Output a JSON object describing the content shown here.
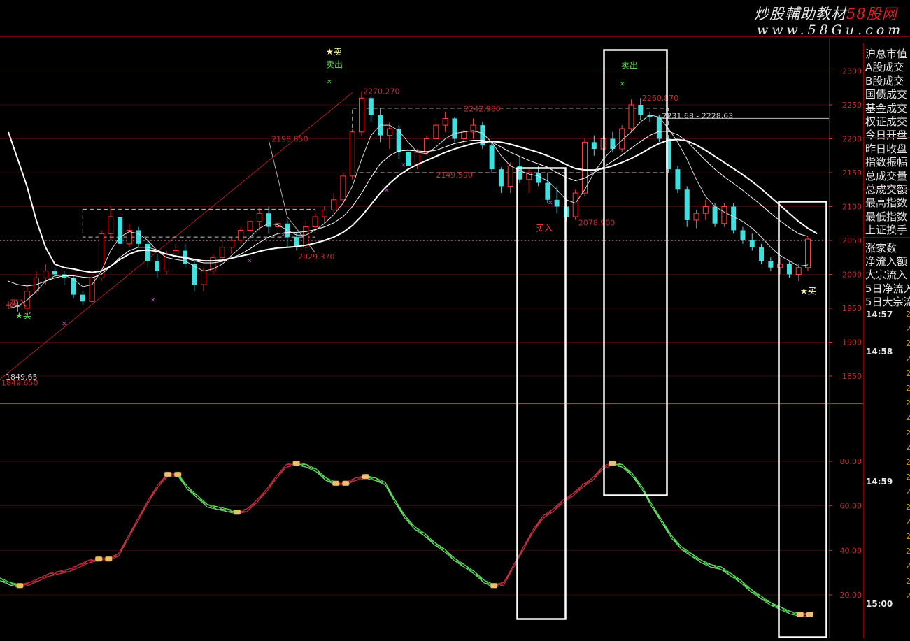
{
  "watermark": {
    "title_a": "炒股輔助教材",
    "title_b": "58股网",
    "url": "www.58Gu.com"
  },
  "panel": {
    "items": [
      "沪总市值",
      "A股成交",
      "B股成交",
      "国债成交",
      "基金成交",
      "权证成交",
      "今日开盘",
      "昨日收盘",
      "指数振幅",
      "总成交量",
      "总成交额",
      "最高指数",
      "最低指数",
      "上证换手",
      "涨家数",
      "净流入额",
      "大宗流入",
      "5日净流入",
      "5日大宗流"
    ],
    "times": [
      "14:57",
      "14:58",
      "14:59",
      "15:00"
    ],
    "digit": "2"
  },
  "colors": {
    "up": "#ff4040",
    "down": "#40e0e0",
    "axis": "#c03030",
    "frame": "#ffffff",
    "osc_up": "#c03040",
    "osc_down": "#60e060"
  },
  "chart_data": [
    {
      "type": "candlestick",
      "y_ticks": [
        1850,
        1900,
        1950,
        2000,
        2050,
        2100,
        2150,
        2200,
        2250,
        2300
      ],
      "ylim": [
        1820,
        2325
      ],
      "reference_level": 2050,
      "ohlc": [
        [
          1955,
          1960,
          1950,
          1955
        ],
        [
          1955,
          1960,
          1945,
          1952
        ],
        [
          1950,
          1985,
          1945,
          1975
        ],
        [
          1975,
          2005,
          1970,
          1995
        ],
        [
          1995,
          2015,
          1985,
          2005
        ],
        [
          2005,
          2010,
          1995,
          2000
        ],
        [
          2000,
          2005,
          1985,
          1995
        ],
        [
          1995,
          1998,
          1965,
          1970
        ],
        [
          1970,
          1975,
          1955,
          1960
        ],
        [
          1960,
          2000,
          1958,
          1995
        ],
        [
          1995,
          2065,
          1990,
          2060
        ],
        [
          2060,
          2100,
          2050,
          2085
        ],
        [
          2085,
          2090,
          2040,
          2045
        ],
        [
          2045,
          2075,
          2040,
          2065
        ],
        [
          2065,
          2070,
          2040,
          2045
        ],
        [
          2045,
          2050,
          2010,
          2020
        ],
        [
          2020,
          2030,
          1995,
          2005
        ],
        [
          2005,
          2035,
          2000,
          2030
        ],
        [
          2030,
          2045,
          2025,
          2035
        ],
        [
          2035,
          2045,
          2010,
          2015
        ],
        [
          2015,
          2020,
          1975,
          1985
        ],
        [
          1985,
          2010,
          1975,
          2005
        ],
        [
          2005,
          2030,
          2000,
          2025
        ],
        [
          2025,
          2050,
          2015,
          2040
        ],
        [
          2040,
          2055,
          2030,
          2050
        ],
        [
          2050,
          2070,
          2045,
          2065
        ],
        [
          2065,
          2085,
          2060,
          2078
        ],
        [
          2078,
          2098,
          2065,
          2090
        ],
        [
          2090,
          2100,
          2060,
          2070
        ],
        [
          2070,
          2085,
          2050,
          2075
        ],
        [
          2075,
          2080,
          2040,
          2055
        ],
        [
          2055,
          2062,
          2035,
          2040
        ],
        [
          2040,
          2080,
          2035,
          2070
        ],
        [
          2070,
          2090,
          2065,
          2085
        ],
        [
          2085,
          2100,
          2075,
          2095
        ],
        [
          2095,
          2120,
          2090,
          2110
        ],
        [
          2110,
          2150,
          2105,
          2145
        ],
        [
          2145,
          2215,
          2140,
          2210
        ],
        [
          2210,
          2270,
          2205,
          2260
        ],
        [
          2260,
          2262,
          2225,
          2235
        ],
        [
          2235,
          2245,
          2195,
          2205
        ],
        [
          2205,
          2225,
          2185,
          2215
        ],
        [
          2215,
          2220,
          2170,
          2180
        ],
        [
          2180,
          2185,
          2150,
          2160
        ],
        [
          2160,
          2185,
          2155,
          2180
        ],
        [
          2180,
          2205,
          2175,
          2200
        ],
        [
          2200,
          2230,
          2195,
          2220
        ],
        [
          2220,
          2240,
          2210,
          2230
        ],
        [
          2230,
          2232,
          2195,
          2200
        ],
        [
          2200,
          2215,
          2190,
          2210
        ],
        [
          2210,
          2230,
          2200,
          2220
        ],
        [
          2220,
          2225,
          2185,
          2190
        ],
        [
          2190,
          2195,
          2150,
          2155
        ],
        [
          2155,
          2158,
          2120,
          2130
        ],
        [
          2130,
          2165,
          2120,
          2160
        ],
        [
          2160,
          2175,
          2135,
          2140
        ],
        [
          2140,
          2158,
          2120,
          2150
        ],
        [
          2150,
          2160,
          2130,
          2135
        ],
        [
          2135,
          2150,
          2105,
          2110
        ],
        [
          2110,
          2130,
          2090,
          2100
        ],
        [
          2100,
          2112,
          2078,
          2085
        ],
        [
          2085,
          2125,
          2080,
          2120
        ],
        [
          2120,
          2200,
          2115,
          2195
        ],
        [
          2195,
          2205,
          2175,
          2185
        ],
        [
          2185,
          2205,
          2175,
          2200
        ],
        [
          2200,
          2210,
          2180,
          2185
        ],
        [
          2185,
          2220,
          2180,
          2215
        ],
        [
          2215,
          2258,
          2210,
          2250
        ],
        [
          2250,
          2260,
          2228,
          2235
        ],
        [
          2235,
          2240,
          2225,
          2232
        ],
        [
          2232,
          2235,
          2195,
          2200
        ],
        [
          2200,
          2205,
          2150,
          2155
        ],
        [
          2155,
          2160,
          2120,
          2125
        ],
        [
          2125,
          2130,
          2070,
          2080
        ],
        [
          2080,
          2095,
          2068,
          2090
        ],
        [
          2090,
          2110,
          2080,
          2100
        ],
        [
          2100,
          2105,
          2070,
          2075
        ],
        [
          2075,
          2105,
          2070,
          2100
        ],
        [
          2100,
          2105,
          2060,
          2065
        ],
        [
          2065,
          2070,
          2045,
          2050
        ],
        [
          2050,
          2060,
          2035,
          2040
        ],
        [
          2040,
          2045,
          2015,
          2020
        ],
        [
          2020,
          2025,
          2005,
          2010
        ],
        [
          2010,
          2025,
          2000,
          2015
        ],
        [
          2015,
          2020,
          1995,
          2000
        ],
        [
          2000,
          2015,
          1990,
          2010
        ],
        [
          2010,
          2055,
          2005,
          2052
        ]
      ],
      "ma_fast": [
        1950,
        1953,
        1962,
        1975,
        1990,
        1998,
        1999,
        1993,
        1982,
        1985,
        2005,
        2035,
        2055,
        2063,
        2060,
        2050,
        2035,
        2025,
        2022,
        2020,
        2012,
        2005,
        2008,
        2015,
        2028,
        2040,
        2055,
        2068,
        2075,
        2073,
        2065,
        2058,
        2058,
        2065,
        2075,
        2088,
        2105,
        2130,
        2170,
        2205,
        2220,
        2220,
        2212,
        2195,
        2180,
        2178,
        2188,
        2200,
        2208,
        2210,
        2212,
        2208,
        2195,
        2175,
        2160,
        2153,
        2148,
        2145,
        2138,
        2125,
        2110,
        2105,
        2125,
        2150,
        2170,
        2185,
        2198,
        2210,
        2225,
        2235,
        2232,
        2215,
        2195,
        2170,
        2140,
        2115,
        2100,
        2092,
        2085,
        2078,
        2068,
        2055,
        2040,
        2028,
        2020,
        2012,
        2014
      ],
      "ma_slow": [
        1990,
        1985,
        1983,
        1985,
        1990,
        1995,
        1998,
        1998,
        1996,
        1995,
        2000,
        2012,
        2025,
        2035,
        2040,
        2040,
        2036,
        2030,
        2026,
        2024,
        2020,
        2017,
        2017,
        2019,
        2024,
        2030,
        2038,
        2047,
        2055,
        2060,
        2062,
        2062,
        2063,
        2066,
        2070,
        2076,
        2085,
        2100,
        2120,
        2143,
        2163,
        2175,
        2182,
        2183,
        2182,
        2181,
        2183,
        2188,
        2193,
        2196,
        2198,
        2198,
        2195,
        2188,
        2180,
        2174,
        2168,
        2163,
        2158,
        2150,
        2143,
        2138,
        2142,
        2150,
        2158,
        2167,
        2176,
        2186,
        2196,
        2205,
        2211,
        2211,
        2206,
        2196,
        2182,
        2168,
        2155,
        2144,
        2134,
        2124,
        2113,
        2102,
        2090,
        2079,
        2069,
        2060,
        2056
      ],
      "ma_long": [
        2210,
        2170,
        2130,
        2080,
        2040,
        2015,
        2010,
        2008,
        2005,
        2003,
        2005,
        2012,
        2022,
        2030,
        2035,
        2036,
        2034,
        2030,
        2027,
        2025,
        2022,
        2020,
        2020,
        2021,
        2024,
        2027,
        2030,
        2034,
        2037,
        2039,
        2040,
        2041,
        2043,
        2046,
        2050,
        2055,
        2062,
        2072,
        2086,
        2103,
        2120,
        2134,
        2146,
        2155,
        2162,
        2168,
        2174,
        2180,
        2185,
        2189,
        2193,
        2195,
        2196,
        2195,
        2192,
        2188,
        2184,
        2180,
        2175,
        2169,
        2162,
        2156,
        2154,
        2154,
        2156,
        2160,
        2165,
        2171,
        2178,
        2186,
        2193,
        2198,
        2199,
        2197,
        2191,
        2183,
        2174,
        2165,
        2156,
        2147,
        2137,
        2126,
        2114,
        2102,
        2090,
        2078,
        2068,
        2060
      ],
      "annotations": [
        "2198.850",
        "2270.270",
        "2242.980",
        "2149.590",
        "2029.370",
        "2078.900",
        "2260.870",
        "2231.68 - 2228.63",
        "1849.65",
        "1849.650"
      ],
      "signals": [
        "买入",
        "★买",
        "★卖",
        "卖出",
        "卖出",
        "买入",
        "★买"
      ]
    },
    {
      "type": "line",
      "y_ticks": [
        20.0,
        40.0,
        60.0,
        80.0
      ],
      "ylim": [
        4,
        92
      ],
      "values": [
        27,
        25,
        24,
        25,
        27,
        29,
        30,
        31,
        33,
        35,
        36,
        36,
        38,
        46,
        54,
        62,
        69,
        74,
        74,
        68,
        64,
        60,
        59,
        58,
        57,
        58,
        62,
        67,
        73,
        78,
        79,
        78,
        76,
        72,
        70,
        70,
        72,
        73,
        72,
        70,
        62,
        55,
        50,
        47,
        43,
        40,
        36,
        33,
        30,
        26,
        24,
        25,
        33,
        41,
        49,
        55,
        58,
        62,
        65,
        69,
        72,
        77,
        79,
        78,
        74,
        68,
        60,
        53,
        46,
        41,
        38,
        35,
        33,
        32,
        29,
        26,
        22,
        19,
        16,
        14,
        12,
        11,
        11
      ]
    }
  ]
}
